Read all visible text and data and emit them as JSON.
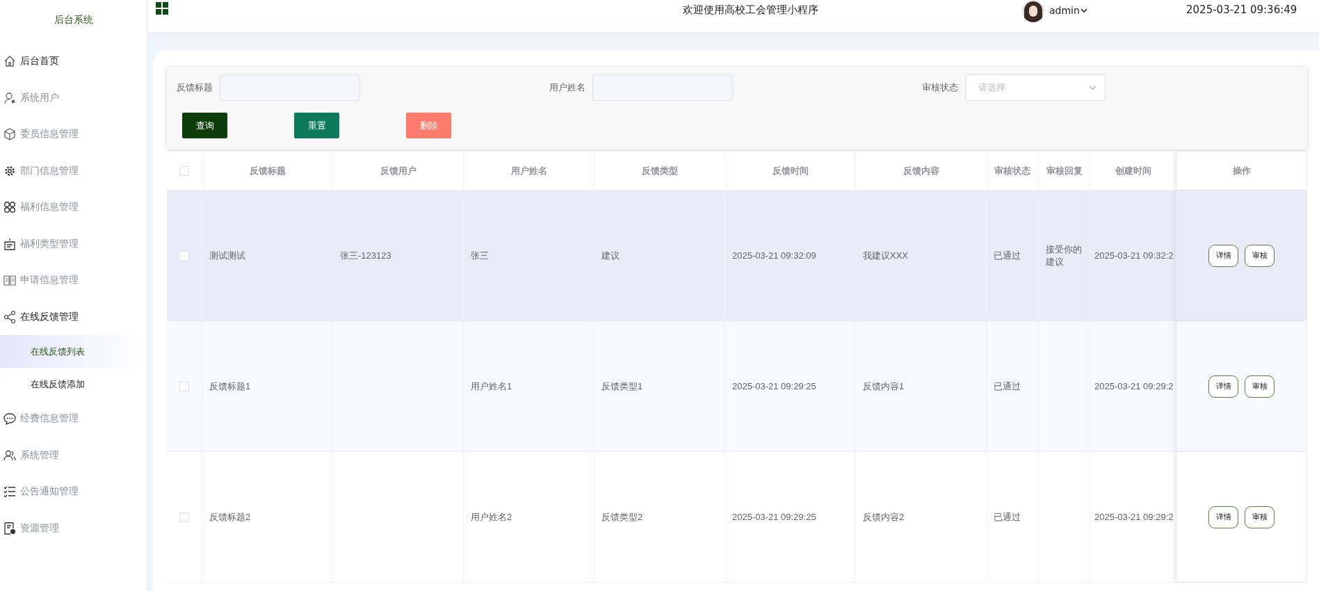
{
  "sidebar": {
    "title": "后台系统",
    "items": [
      {
        "label": "后台首页",
        "active": true
      },
      {
        "label": "系统用户",
        "active": false
      },
      {
        "label": "委员信息管理",
        "active": false
      },
      {
        "label": "部门信息管理",
        "active": false
      },
      {
        "label": "福利信息管理",
        "active": false
      },
      {
        "label": "福利类型管理",
        "active": false
      },
      {
        "label": "申请信息管理",
        "active": false
      },
      {
        "label": "在线反馈管理",
        "active": true,
        "expanded": true,
        "children": [
          {
            "label": "在线反馈列表",
            "selected": true
          },
          {
            "label": "在线反馈添加",
            "selected": false
          }
        ]
      },
      {
        "label": "经费信息管理",
        "active": false
      },
      {
        "label": "系统管理",
        "active": false
      },
      {
        "label": "公告通知管理",
        "active": false
      },
      {
        "label": "资源管理",
        "active": false
      }
    ]
  },
  "header": {
    "title": "欢迎使用高校工会管理小程序",
    "user": "admin",
    "datetime": "2025-03-21 09:36:49"
  },
  "filters": [
    {
      "label": "反馈标题",
      "kind": "input"
    },
    {
      "label": "用户姓名",
      "kind": "input"
    },
    {
      "label": "审核状态",
      "kind": "select",
      "placeholder": "请选择"
    }
  ],
  "buttons": [
    {
      "label": "查询",
      "kind": "search"
    },
    {
      "label": "重置",
      "kind": "reset"
    },
    {
      "label": "删除",
      "kind": "delete"
    }
  ],
  "table": {
    "select_all": {
      "checked": false
    },
    "columns": [
      "反馈标题",
      "反馈用户",
      "用户姓名",
      "反馈类型",
      "反馈时间",
      "反馈内容",
      "审核状态",
      "审核回复",
      "创建时间",
      "操作"
    ],
    "rows": [
      {
        "checked": false,
        "hovered": true,
        "cells": [
          "测试测试",
          "张三-123123",
          "张三",
          "建议",
          "2025-03-21 09:32:09",
          "我建议XXX",
          "已通过",
          "接受你的建议",
          "2025-03-21 09:32:2"
        ],
        "actions": [
          "详情",
          "审核"
        ]
      },
      {
        "checked": false,
        "hovered": false,
        "cells": [
          "反馈标题1",
          "",
          "用户姓名1",
          "反馈类型1",
          "2025-03-21 09:29:25",
          "反馈内容1",
          "已通过",
          "",
          "2025-03-21 09:29:2"
        ],
        "actions": [
          "详情",
          "审核"
        ]
      },
      {
        "checked": false,
        "hovered": false,
        "cells": [
          "反馈标题2",
          "",
          "用户姓名2",
          "反馈类型2",
          "2025-03-21 09:29:25",
          "反馈内容2",
          "已通过",
          "",
          "2025-03-21 09:29:2"
        ],
        "actions": [
          "详情",
          "审核"
        ]
      }
    ]
  }
}
